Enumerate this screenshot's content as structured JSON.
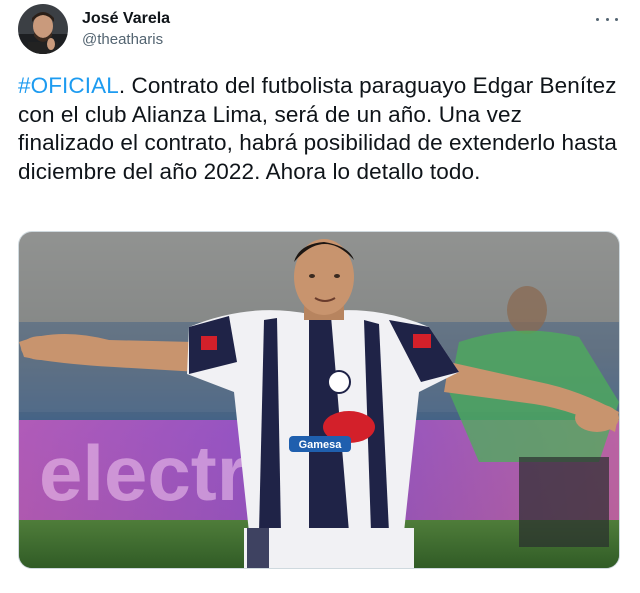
{
  "author": {
    "display_name": "José Varela",
    "handle": "@theatharis"
  },
  "tweet": {
    "hashtag": "#OFICIAL",
    "body": ". Contrato del futbolista paraguayo Edgar Benítez con el club Alianza Lima, será de un año. Una vez finalizado el contrato, habrá posibilidad de extenderlo hasta diciembre del año 2022. Ahora lo detallo todo."
  },
  "photo": {
    "jersey_sponsor": "Gamesa",
    "board_text": "electro"
  },
  "icons": {
    "more": "more-horizontal-icon"
  },
  "colors": {
    "link": "#1d9bf0",
    "text": "#0f1419",
    "secondary": "#536471"
  }
}
